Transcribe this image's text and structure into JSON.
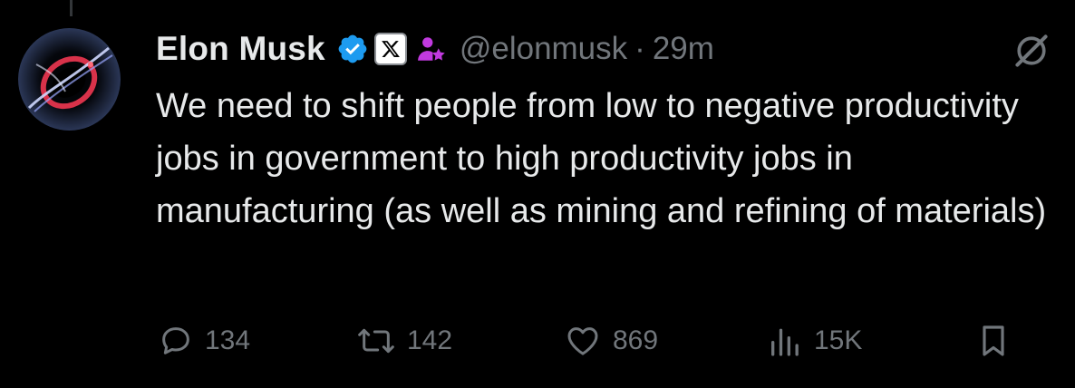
{
  "tweet": {
    "author": {
      "name": "Elon Musk",
      "handle": "@elonmusk",
      "time_separator": "·",
      "time": "29m"
    },
    "text": "We need to shift people from low to negative productivity jobs in government to high productivity jobs in manufacturing (as well as mining and refining of materials)",
    "stats": {
      "replies": "134",
      "reposts": "142",
      "likes": "869",
      "views": "15K"
    },
    "icons": {
      "avatar": "avatar-image",
      "verified": "verified-badge-icon",
      "affiliation": "x-logo-badge-icon",
      "affiliate_person": "affiliate-person-icon",
      "grok": "grok-icon",
      "reply": "reply-icon",
      "repost": "repost-icon",
      "like": "heart-icon",
      "views": "views-chart-icon",
      "bookmark": "bookmark-icon"
    },
    "colors": {
      "background": "#000000",
      "text_primary": "#e7e9ea",
      "text_secondary": "#71767b",
      "verified_blue": "#1d9bf0",
      "affiliate_purple": "#c13adf"
    }
  }
}
